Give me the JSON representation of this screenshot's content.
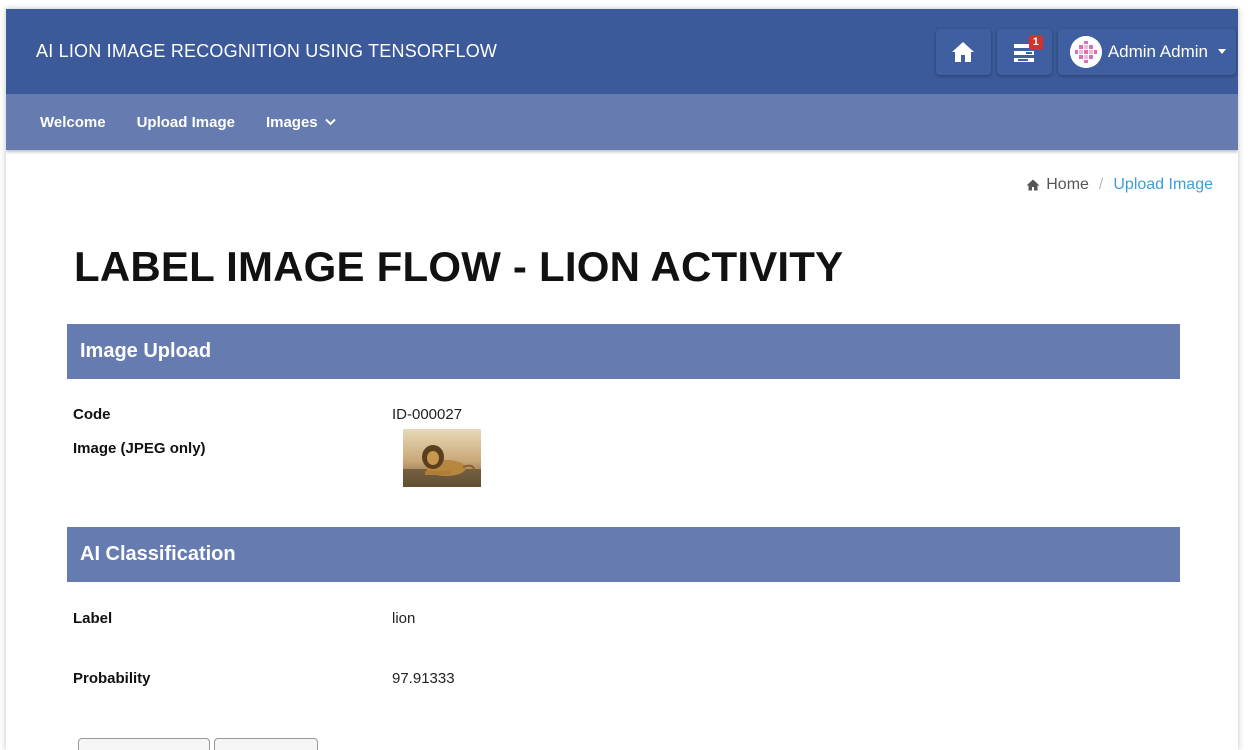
{
  "header": {
    "title": "AI LION IMAGE RECOGNITION USING TENSORFLOW",
    "notification_count": "1",
    "user_name": "Admin Admin",
    "icons": {
      "home": "home-icon",
      "tasks": "tasks-icon",
      "avatar": "avatar-icon",
      "caret": "caret-down-icon"
    }
  },
  "nav": {
    "items": [
      {
        "label": "Welcome"
      },
      {
        "label": "Upload Image"
      },
      {
        "label": "Images"
      }
    ]
  },
  "breadcrumb": {
    "home": "Home",
    "separator": "/",
    "current": "Upload Image"
  },
  "page": {
    "title": "LABEL IMAGE FLOW - LION ACTIVITY"
  },
  "upload": {
    "header": "Image Upload",
    "code_label": "Code",
    "code_value": "ID-000027",
    "image_label": "Image (JPEG only)"
  },
  "classification": {
    "header": "AI Classification",
    "label_label": "Label",
    "label_value": "lion",
    "probability_label": "Probability",
    "probability_value": "97.91333"
  },
  "colors": {
    "topbar": "#3c5a9a",
    "navbar": "#667bb0",
    "panel_header": "#667bb0",
    "breadcrumb_active": "#3a9fd8",
    "badge": "#d9302c"
  }
}
